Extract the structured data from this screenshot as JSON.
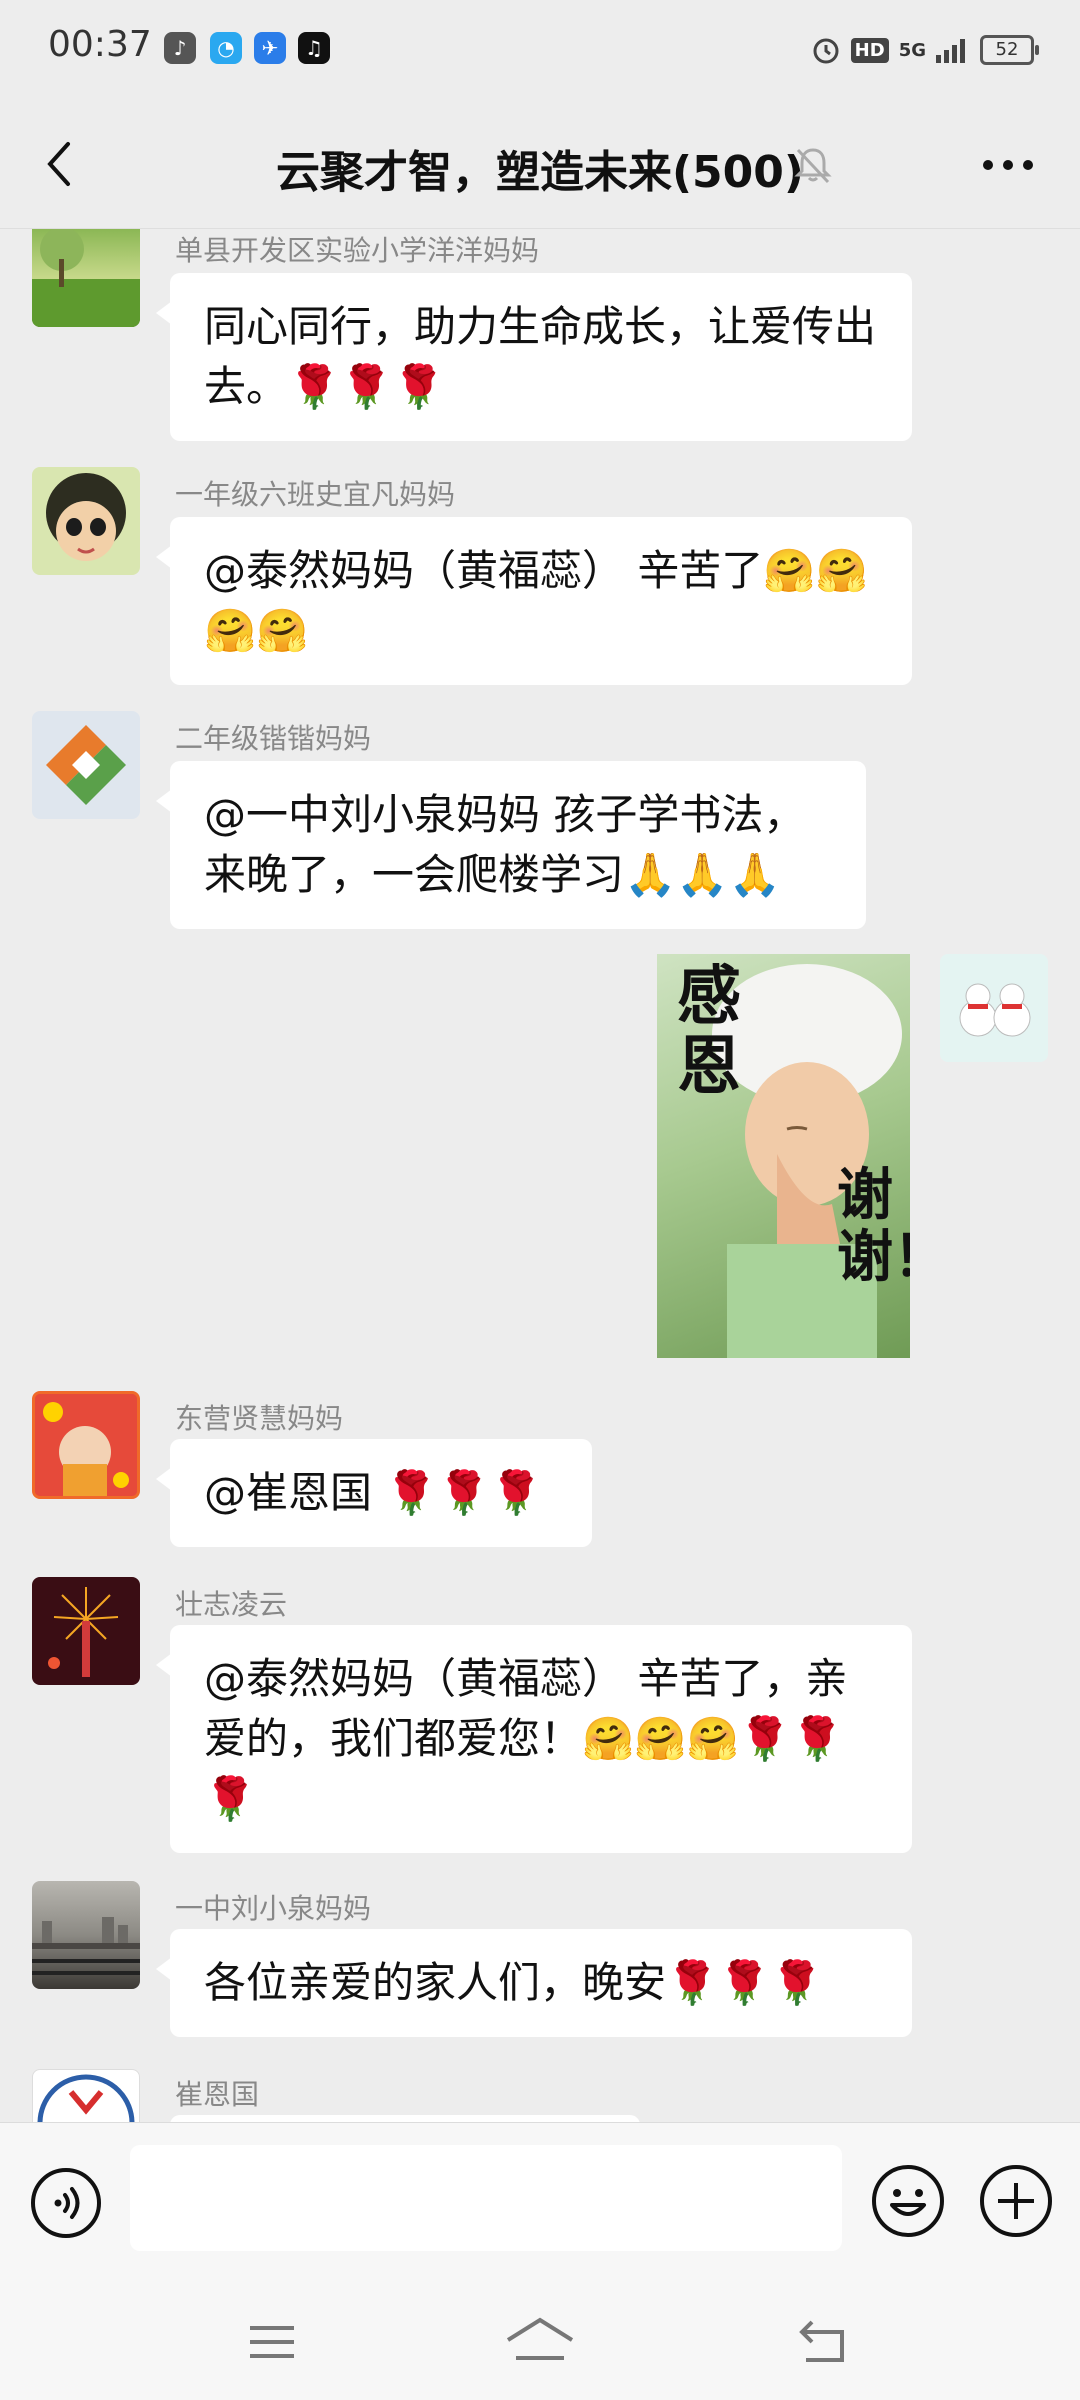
{
  "status_bar": {
    "time": "00:37",
    "battery": "52",
    "network": "5G",
    "hd": "HD"
  },
  "nav": {
    "title": "云聚才智，塑造未来(500)"
  },
  "messages": [
    {
      "sender": "单县开发区实验小学洋洋妈妈",
      "text": "同心同行，助力生命成长，让爱传出去。🌹🌹🌹"
    },
    {
      "sender": "一年级六班史宜凡妈妈",
      "text": "@泰然妈妈（黄福蕊） 辛苦了🤗🤗🤗🤗"
    },
    {
      "sender": "二年级锴锴妈妈",
      "text": "@一中刘小泉妈妈  孩子学书法，来晚了，一会爬楼学习🙏🙏🙏"
    },
    {
      "sender": "东营贤慧妈妈",
      "text": "@崔恩国 🌹🌹🌹"
    },
    {
      "sender": "壮志凌云",
      "text": "@泰然妈妈（黄福蕊） 辛苦了，亲爱的，我们都爱您！🤗🤗🤗🌹🌹🌹"
    },
    {
      "sender": "一中刘小泉妈妈",
      "text": "各位亲爱的家人们，晚安🌹🌹🌹"
    },
    {
      "sender": "崔恩国",
      "text": ""
    }
  ],
  "sticker": {
    "caption_left": "感恩",
    "caption_right": "谢谢！"
  },
  "input": {
    "value": "",
    "placeholder": ""
  },
  "colors": {
    "background": "#ededed",
    "bubble": "#ffffff",
    "sender_name": "#888888"
  },
  "icons": [
    "back-arrow-icon",
    "mute-bell-icon",
    "more-icon",
    "voice-icon",
    "emoji-icon",
    "plus-icon",
    "menu-icon",
    "home-icon",
    "return-icon"
  ]
}
